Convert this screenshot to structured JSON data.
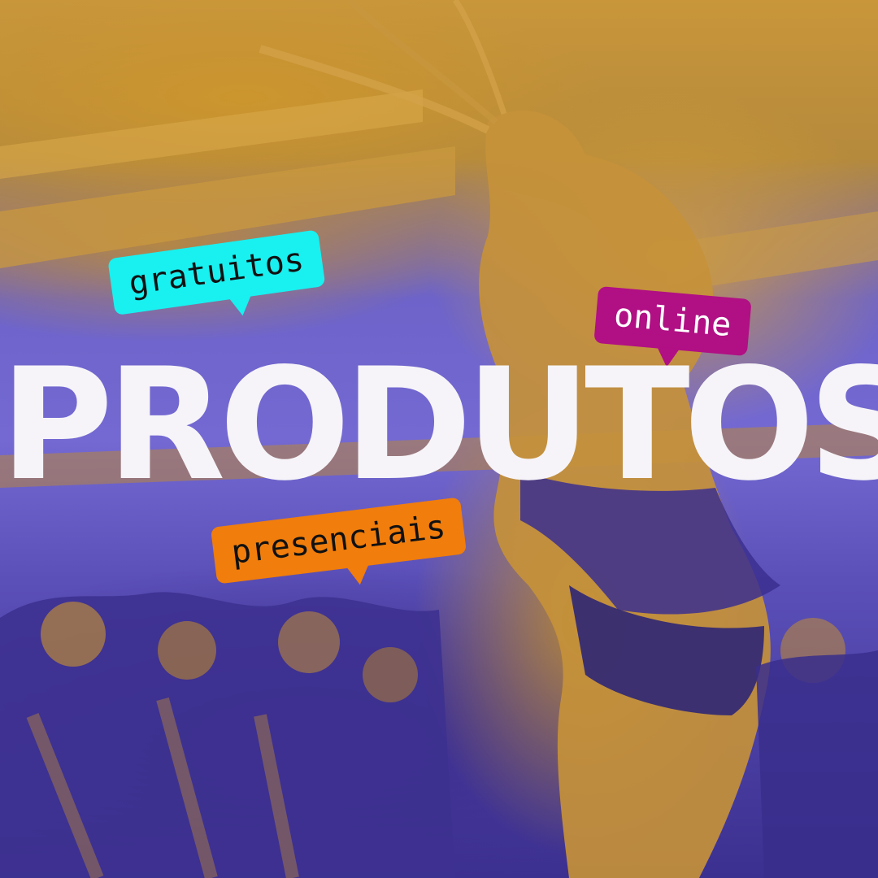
{
  "headline": "PRODUTOS",
  "tags": {
    "gratuitos": "gratuitos",
    "online": "online",
    "presenciais": "presenciais"
  },
  "colors": {
    "headline": "#f6f4f8",
    "tag_gratuitos": "#19f0f0",
    "tag_online": "#b10f84",
    "tag_presenciais": "#f07d0c",
    "photo_tint_warm": "#c9963a",
    "photo_tint_cool": "#6d63c9"
  }
}
